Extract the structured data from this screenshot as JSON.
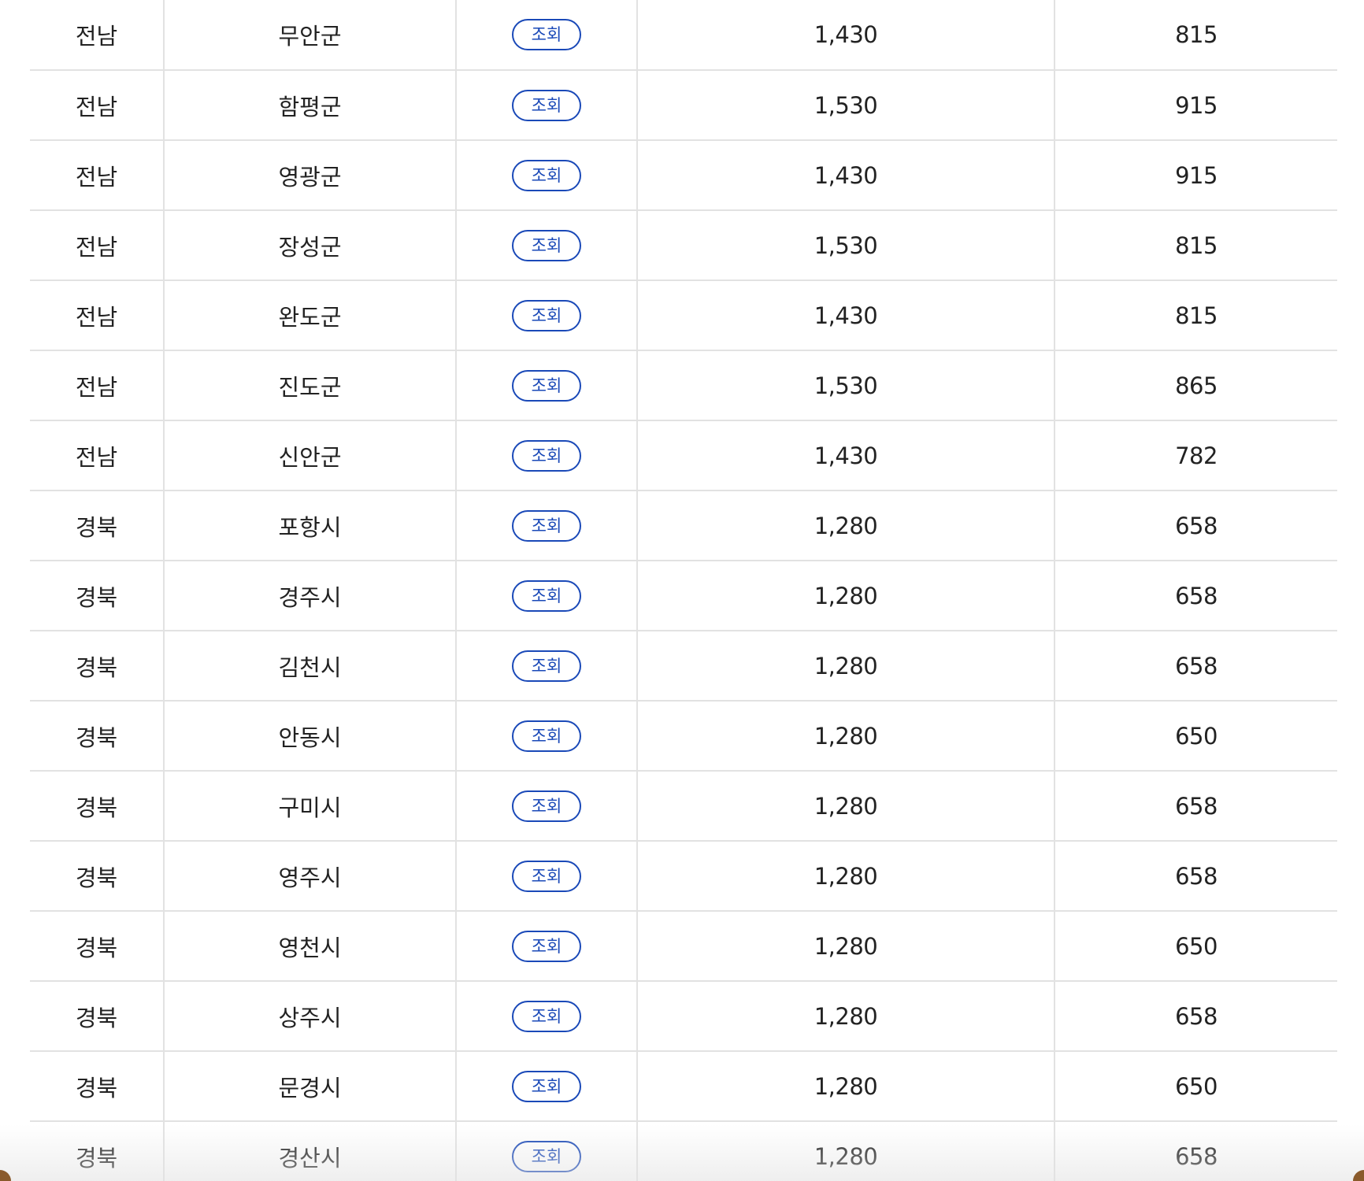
{
  "table": {
    "button_label": "조회",
    "rows": [
      {
        "region": "전남",
        "district": "무안군",
        "value1": "1,430",
        "value2": "815"
      },
      {
        "region": "전남",
        "district": "함평군",
        "value1": "1,530",
        "value2": "915"
      },
      {
        "region": "전남",
        "district": "영광군",
        "value1": "1,430",
        "value2": "915"
      },
      {
        "region": "전남",
        "district": "장성군",
        "value1": "1,530",
        "value2": "815"
      },
      {
        "region": "전남",
        "district": "완도군",
        "value1": "1,430",
        "value2": "815"
      },
      {
        "region": "전남",
        "district": "진도군",
        "value1": "1,530",
        "value2": "865"
      },
      {
        "region": "전남",
        "district": "신안군",
        "value1": "1,430",
        "value2": "782"
      },
      {
        "region": "경북",
        "district": "포항시",
        "value1": "1,280",
        "value2": "658"
      },
      {
        "region": "경북",
        "district": "경주시",
        "value1": "1,280",
        "value2": "658"
      },
      {
        "region": "경북",
        "district": "김천시",
        "value1": "1,280",
        "value2": "658"
      },
      {
        "region": "경북",
        "district": "안동시",
        "value1": "1,280",
        "value2": "650"
      },
      {
        "region": "경북",
        "district": "구미시",
        "value1": "1,280",
        "value2": "658"
      },
      {
        "region": "경북",
        "district": "영주시",
        "value1": "1,280",
        "value2": "658"
      },
      {
        "region": "경북",
        "district": "영천시",
        "value1": "1,280",
        "value2": "650"
      },
      {
        "region": "경북",
        "district": "상주시",
        "value1": "1,280",
        "value2": "658"
      },
      {
        "region": "경북",
        "district": "문경시",
        "value1": "1,280",
        "value2": "650"
      },
      {
        "region": "경북",
        "district": "경산시",
        "value1": "1,280",
        "value2": "658"
      }
    ]
  },
  "colors": {
    "button_accent": "#1a49b8",
    "grid_line": "#e2e2e2",
    "text": "#222222"
  }
}
